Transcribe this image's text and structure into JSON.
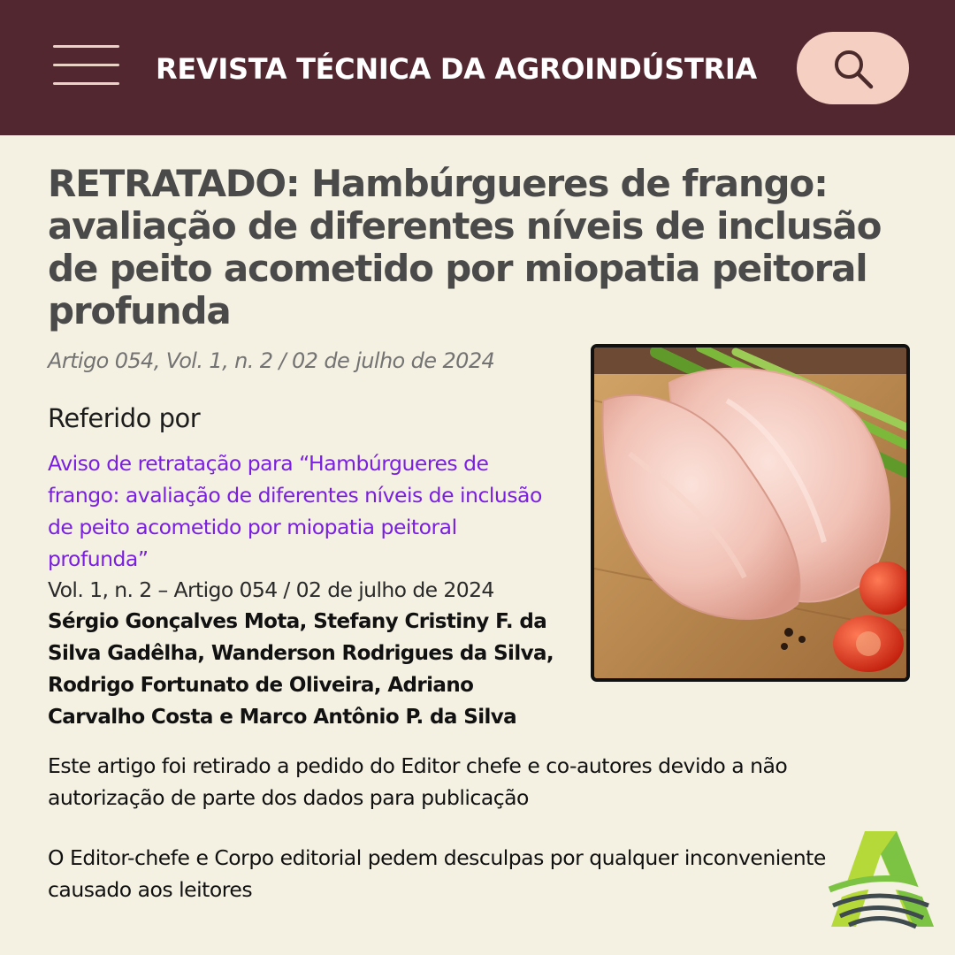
{
  "header": {
    "site_title": "REVISTA TÉCNICA DA AGROINDÚSTRIA",
    "menu_icon": "hamburger-menu-icon",
    "search_icon": "search-icon"
  },
  "article": {
    "title": "RETRATADO: Hambúrgueres de frango: avaliação de diferentes níveis de inclusão de peito acometido por miopatia peitoral profunda",
    "meta": "Artigo 054, Vol. 1, n. 2 / 02 de julho de 2024",
    "referred_by_label": "Referido por",
    "notice_link": "Aviso de retratação para “Hambúrgueres de frango: avaliação de diferentes níveis de inclusão de peito acometido por miopatia peitoral profunda”",
    "notice_reference": "Vol. 1, n. 2 – Artigo 054 / 02 de julho de 2024",
    "authors": "Sérgio Gonçalves Mota, Stefany Cristiny F. da Silva Gadêlha, Wanderson Rodrigues da Silva, Rodrigo Fortunato de Oliveira, Adriano Carvalho Costa e Marco Antônio P. da Silva",
    "paragraph_1": "Este artigo foi retirado a pedido do Editor chefe e co-autores devido a não autorização de parte dos dados para publicação",
    "paragraph_2": "O Editor-chefe e Corpo editorial pedem desculpas por qualquer inconveniente causado aos leitores",
    "image": "raw-chicken-breast-photo"
  },
  "colors": {
    "header_bg": "#532730",
    "search_button_bg": "#f4cfc2",
    "page_bg": "#f4f1e3",
    "title_color": "#4a4a4a",
    "link_color": "#7a1fe0",
    "logo_green": "#7cc243",
    "logo_lime": "#b6d93a"
  },
  "footer": {
    "logo": "journal-logo-icon"
  }
}
